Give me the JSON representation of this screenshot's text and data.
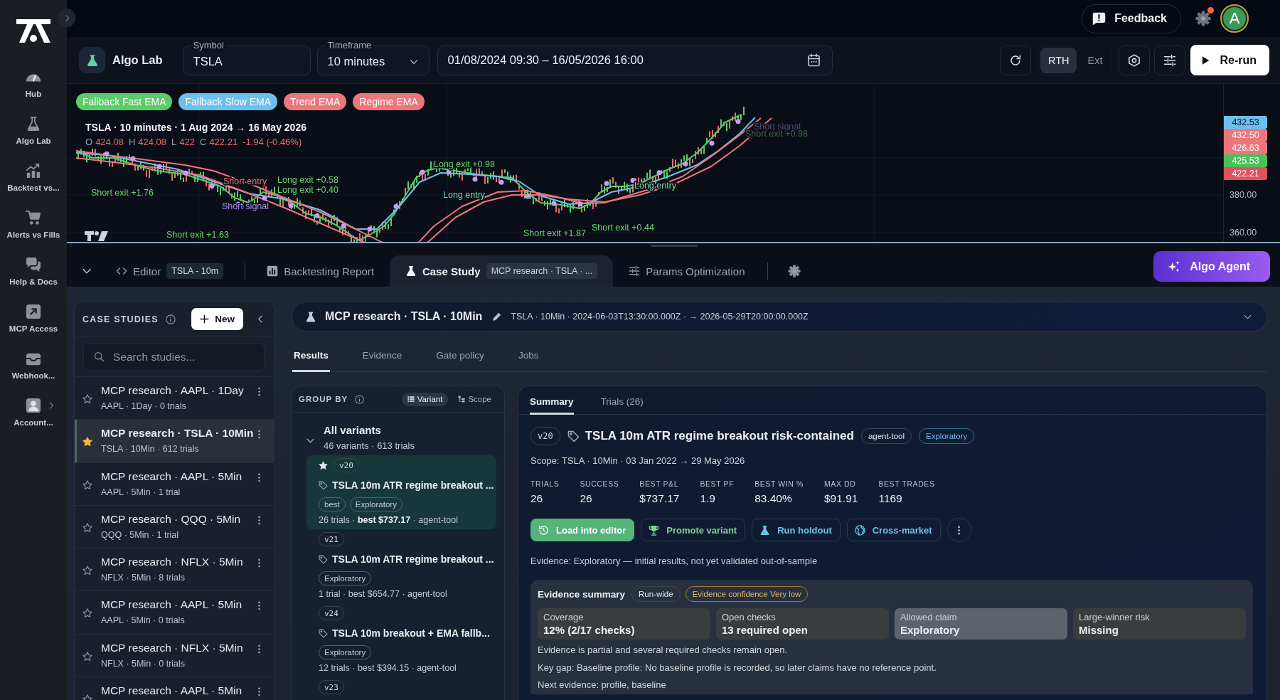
{
  "sidebar": {
    "items": [
      {
        "label": "Hub",
        "expandable": false
      },
      {
        "label": "Algo Lab",
        "expandable": false
      },
      {
        "label": "Backtest vs...",
        "expandable": false
      },
      {
        "label": "Alerts vs Fills",
        "expandable": false
      },
      {
        "label": "Help & Docs",
        "expandable": false
      },
      {
        "label": "MCP Access",
        "expandable": false
      },
      {
        "label": "Webhook...",
        "expandable": false
      },
      {
        "label": "Account...",
        "expandable": true
      }
    ]
  },
  "top_bar": {
    "feedback_button": "Feedback",
    "settings_alert": true,
    "avatar": "A"
  },
  "toolbar": {
    "title": "Algo Lab",
    "symbol": {
      "label": "Symbol",
      "value": "TSLA"
    },
    "timeframe": {
      "label": "Timeframe",
      "value": "10 minutes"
    },
    "date_range": {
      "value": "01/08/2024 09:30 – 16/05/2026 16:00"
    },
    "session": [
      {
        "label": "RTH",
        "selected": true
      },
      {
        "label": "Ext",
        "selected": false
      }
    ],
    "rerun_button": "Re-run"
  },
  "chart": {
    "legend": [
      {
        "label": "Fallback Fast EMA",
        "color": "#5ccc6a"
      },
      {
        "label": "Fallback Slow EMA",
        "color": "#6cc0f0"
      },
      {
        "label": "Trend EMA",
        "color": "#ec767c"
      },
      {
        "label": "Regime EMA",
        "color": "#ec767c"
      }
    ],
    "title": "TSLA · 10 minutes · 1 Aug 2024 → 16 May 2026",
    "ohlc": [
      {
        "label": "O",
        "value": "424.08"
      },
      {
        "label": "H",
        "value": "424.08"
      },
      {
        "label": "L",
        "value": "422"
      },
      {
        "label": "C",
        "value": "422.21"
      }
    ],
    "change": "-1.94 (-0.46%)",
    "trade_labels": [
      {
        "text": "Short exit +1.76",
        "kind": "exit",
        "dimmed": false
      },
      {
        "text": "Short signal",
        "kind": "signal",
        "dimmed": false
      },
      {
        "text": "Short exit +1.63",
        "kind": "exit",
        "dimmed": false
      },
      {
        "text": "Short entry",
        "kind": "short-entry",
        "dimmed": false
      },
      {
        "text": "Long exit +0.58",
        "kind": "exit",
        "dimmed": false
      },
      {
        "text": "Long exit +0.40",
        "kind": "exit",
        "dimmed": false
      },
      {
        "text": "Long exit +0.98",
        "kind": "exit",
        "dimmed": false
      },
      {
        "text": "Long entry",
        "kind": "long-entry",
        "dimmed": false
      },
      {
        "text": "Short exit +1.87",
        "kind": "exit",
        "dimmed": false
      },
      {
        "text": "Short exit +0.44",
        "kind": "exit",
        "dimmed": false
      },
      {
        "text": "Long entry",
        "kind": "long-entry",
        "dimmed": false
      },
      {
        "text": "Short signal",
        "kind": "signal",
        "dimmed": true
      },
      {
        "text": "Short exit +0.98",
        "kind": "exit",
        "dimmed": true
      }
    ],
    "price_tags": [
      {
        "value": "432.53",
        "color": "#6cc0f0"
      },
      {
        "value": "432.50",
        "color": "#ec767c"
      },
      {
        "value": "426.63",
        "color": "#ec767c"
      },
      {
        "value": "425.53",
        "color": "#4cbf5c"
      },
      {
        "value": "422.21",
        "color": "#e0525f"
      }
    ],
    "axis_labels": [
      "380.00",
      "360.00"
    ]
  },
  "panel_tabs": [
    {
      "label": "Editor",
      "chip": "TSLA - 10m",
      "selected": false
    },
    {
      "label": "Backtesting Report",
      "selected": false
    },
    {
      "label": "Case Study",
      "chip": "MCP research · TSLA · ...",
      "selected": true
    },
    {
      "label": "Params Optimization",
      "selected": false
    }
  ],
  "agent_button": "Algo Agent",
  "case_studies": {
    "title": "CASE STUDIES",
    "new_button": "New",
    "search": {
      "placeholder": "Search studies..."
    },
    "items": [
      {
        "title": "MCP research · AAPL · 1Day",
        "meta": "AAPL · 1Day · 0 trials",
        "starred": false,
        "selected": false
      },
      {
        "title": "MCP research · TSLA · 10Min",
        "meta": "TSLA · 10Min · 612 trials",
        "starred": true,
        "selected": true
      },
      {
        "title": "MCP research · AAPL · 5Min",
        "meta": "AAPL · 5Min · 1 trial",
        "starred": false,
        "selected": false
      },
      {
        "title": "MCP research · QQQ · 5Min",
        "meta": "QQQ · 5Min · 1 trial",
        "starred": false,
        "selected": false
      },
      {
        "title": "MCP research · NFLX · 5Min",
        "meta": "NFLX · 5Min · 8 trials",
        "starred": false,
        "selected": false
      },
      {
        "title": "MCP research · AAPL · 5Min",
        "meta": "AAPL · 5Min · 0 trials",
        "starred": false,
        "selected": false
      },
      {
        "title": "MCP research · NFLX · 5Min",
        "meta": "NFLX · 5Min · 0 trials",
        "starred": false,
        "selected": false
      },
      {
        "title": "MCP research · AAPL · 5Min",
        "starred": false,
        "selected": false
      }
    ]
  },
  "study": {
    "title": "MCP research · TSLA · 10Min",
    "meta": "TSLA · 10Min · 2024-06-03T13:30:00.000Z · → 2026-05-29T20:00:00.000Z",
    "tabs": [
      {
        "label": "Results",
        "selected": true
      },
      {
        "label": "Evidence",
        "selected": false
      },
      {
        "label": "Gate policy",
        "selected": false
      },
      {
        "label": "Jobs",
        "selected": false
      }
    ]
  },
  "group_by": {
    "title": "GROUP BY",
    "options": [
      {
        "label": "Variant",
        "selected": true
      },
      {
        "label": "Scope",
        "selected": false
      }
    ],
    "group": {
      "title": "All variants",
      "meta": "46 variants · 613 trials",
      "expanded": true
    },
    "variants": [
      {
        "version": "v20",
        "starred": true,
        "selected": true,
        "name": "TSLA 10m ATR regime breakout ...",
        "tags": [
          "best",
          "Exploratory"
        ],
        "summary": "26 trials · **best $737.17** · agent-tool"
      },
      {
        "version": "v21",
        "starred": false,
        "selected": false,
        "name": "TSLA 10m ATR regime breakout ...",
        "tags": [
          "Exploratory"
        ],
        "summary": "1 trial · best $654.77 · agent-tool"
      },
      {
        "version": "v24",
        "starred": false,
        "selected": false,
        "name": "TSLA 10m breakout + EMA fallb...",
        "tags": [
          "Exploratory"
        ],
        "summary": "12 trials · best $394.15 · agent-tool"
      },
      {
        "version": "v23",
        "starred": false,
        "selected": false
      }
    ]
  },
  "variant_detail": {
    "tabs": [
      {
        "label": "Summary",
        "selected": true
      },
      {
        "label": "Trials (26)",
        "selected": false
      }
    ],
    "version": "v20",
    "title": "TSLA 10m ATR regime breakout risk-contained",
    "tags": [
      {
        "label": "agent-tool",
        "kind": "neutral"
      },
      {
        "label": "Exploratory",
        "kind": "info"
      }
    ],
    "scope": "Scope: TSLA · 10Min · 03 Jan 2022 → 29 May 2026",
    "stats": [
      {
        "label": "TRIALS",
        "value": "26"
      },
      {
        "label": "SUCCESS",
        "value": "26"
      },
      {
        "label": "BEST P&L",
        "value": "$737.17"
      },
      {
        "label": "BEST PF",
        "value": "1.9"
      },
      {
        "label": "BEST WIN %",
        "value": "83.40%"
      },
      {
        "label": "MAX DD",
        "value": "$91.91"
      },
      {
        "label": "BEST TRADES",
        "value": "1169"
      }
    ],
    "actions": [
      {
        "label": "Load into editor",
        "kind": "primary"
      },
      {
        "label": "Promote variant",
        "kind": "success"
      },
      {
        "label": "Run holdout",
        "kind": "info"
      },
      {
        "label": "Cross-market",
        "kind": "info"
      }
    ],
    "evidence_note": "Evidence: Exploratory — initial results, not yet validated out-of-sample",
    "evidence_summary": {
      "title": "Evidence summary",
      "tags": [
        {
          "label": "Run-wide",
          "kind": "neutral"
        },
        {
          "label": "Evidence confidence Very low",
          "kind": "warning"
        }
      ],
      "cards": [
        {
          "label": "Coverage",
          "value": "12% (2/17 checks)",
          "highlighted": false
        },
        {
          "label": "Open checks",
          "value": "13 required open",
          "highlighted": false
        },
        {
          "label": "Allowed claim",
          "value": "Exploratory",
          "highlighted": true
        },
        {
          "label": "Large-winner risk",
          "value": "Missing",
          "highlighted": false
        }
      ],
      "lines": [
        "Evidence is partial and several required checks remain open.",
        "Key gap: Baseline profile: No baseline profile is recorded, so later claims have no reference point.",
        "Next evidence: profile, baseline"
      ]
    }
  }
}
